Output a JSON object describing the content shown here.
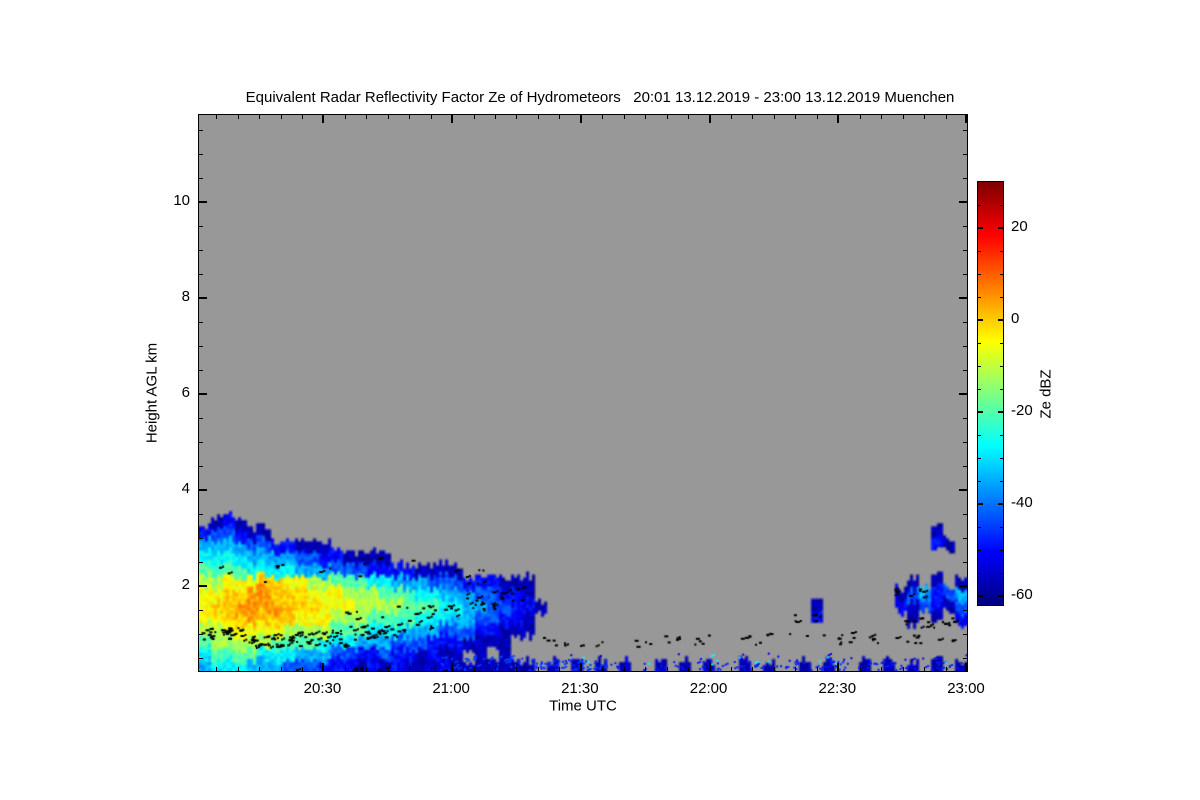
{
  "title": "Equivalent Radar Reflectivity Factor Ze of Hydrometeors   20:01 13.12.2019 - 23:00 13.12.2019 Muenchen",
  "station": "Muenchen",
  "period": "20:01 13.12.2019 - 23:00 13.12.2019",
  "colors": {
    "background": "#ffffff",
    "no_echo_gray": "#989898",
    "frame": "#000000",
    "text": "#000000",
    "dot_marker": "#000000"
  },
  "chart_data": {
    "type": "heatmap",
    "title": "Equivalent Radar Reflectivity Factor Ze of Hydrometeors   20:01 13.12.2019 - 23:00 13.12.2019 Muenchen",
    "xlabel": "Time UTC",
    "ylabel": "Height AGL km",
    "x_start_utc": "20:01",
    "x_end_utc": "23:00",
    "x_total_min": 179,
    "x_major_ticks": [
      {
        "label": "20:30",
        "min": 29
      },
      {
        "label": "21:00",
        "min": 59
      },
      {
        "label": "21:30",
        "min": 89
      },
      {
        "label": "22:00",
        "min": 119
      },
      {
        "label": "22:30",
        "min": 149
      },
      {
        "label": "23:00",
        "min": 179
      }
    ],
    "x_minor_step_min": 5,
    "ylim_km": [
      0.23,
      11.81
    ],
    "y_major_ticks": [
      {
        "label": "2",
        "km": 2
      },
      {
        "label": "4",
        "km": 4
      },
      {
        "label": "6",
        "km": 6
      },
      {
        "label": "8",
        "km": 8
      },
      {
        "label": "10",
        "km": 10
      }
    ],
    "y_minor_step_km": 0.5,
    "grid_lines": false,
    "colorbar": {
      "label": "Ze dBZ",
      "units": "dBZ",
      "colormap": "jet",
      "vmin": -62,
      "vmax": 30,
      "major_ticks": [
        {
          "label": "20",
          "v": 20
        },
        {
          "label": "0",
          "v": 0
        },
        {
          "label": "-20",
          "v": -20
        },
        {
          "label": "-40",
          "v": -40
        },
        {
          "label": "-60",
          "v": -60
        }
      ],
      "minor_step": 5
    },
    "grid": {
      "comment": "Coded dBZ raster of radar echo, 64 time columns x 15 height rows; '.'=no echo",
      "t0_min": 0,
      "dt_min": 2.797,
      "h_bottom_km": 0.23,
      "h_top_km": 4.0,
      "n_cols": 64,
      "n_rows": 15,
      "value_codes": {
        "a": -57,
        "b": -50,
        "c": -43,
        "d": -35,
        "e": -28,
        "f": -20,
        "g": -12,
        "h": -5,
        "i": 0,
        "j": 5
      },
      "rows_top_to_bottom": [
        "................................................................",
        "................................................................",
        ".aba............................................................",
        "bccbaa.......................................................a..",
        "ddddccbbaaa..................................................ba.",
        "eeeeddddccbbaaaa................................................",
        "ffffeeeedddcccbbbbaaaa..........................................",
        "gghhhiihhggfffeedddcccbbbaaa...............................a.a.a",
        "hhiijjiiihhhgggfffeedddccbba..............................acdbcd",
        "hiijjjjiiihhhggggfffeeddccbba......................a......bacbac",
        "hhiijiiihhhgggffffeeeddccbba.......................b.......a.a.b",
        "gghhhhhggggfffeeedddcccbbaaa....................................",
        "fgggggffffeeedddcccbbbaaaa......................................",
        "effffeeedddccbbcbbabaa.a.a......................................",
        "deeedddcccbbbababaaabaaaaaaa.a.a.a.a..a.a.a..a.a..a.a..a.a.a.a.a"
      ]
    },
    "black_dot_bands": [
      {
        "t0": 0,
        "t1": 10,
        "h0": 0.9,
        "h1": 1.15,
        "n": 34
      },
      {
        "t0": 10,
        "t1": 22,
        "h0": 0.72,
        "h1": 1.0,
        "n": 40
      },
      {
        "t0": 22,
        "t1": 34,
        "h0": 0.75,
        "h1": 1.1,
        "n": 34
      },
      {
        "t0": 34,
        "t1": 46,
        "h0": 0.9,
        "h1": 1.2,
        "n": 28
      },
      {
        "t0": 46,
        "t1": 55,
        "h0": 1.05,
        "h1": 1.3,
        "n": 10
      },
      {
        "t0": 50,
        "t1": 60,
        "h0": 1.35,
        "h1": 1.65,
        "n": 14
      },
      {
        "t0": 60,
        "t1": 70,
        "h0": 1.5,
        "h1": 1.85,
        "n": 16
      },
      {
        "t0": 68,
        "t1": 77,
        "h0": 1.7,
        "h1": 2.0,
        "n": 12
      },
      {
        "t0": 57,
        "t1": 68,
        "h0": 2.05,
        "h1": 2.35,
        "n": 7
      },
      {
        "t0": 4,
        "t1": 50,
        "h0": 2.1,
        "h1": 2.65,
        "n": 12
      },
      {
        "t0": 30,
        "t1": 50,
        "h0": 1.3,
        "h1": 1.6,
        "n": 7
      },
      {
        "t0": 20,
        "t1": 62,
        "h0": 0.24,
        "h1": 0.32,
        "n": 10
      },
      {
        "t0": 80,
        "t1": 105,
        "h0": 0.75,
        "h1": 1.0,
        "n": 14
      },
      {
        "t0": 105,
        "t1": 130,
        "h0": 0.78,
        "h1": 1.0,
        "n": 13
      },
      {
        "t0": 130,
        "t1": 160,
        "h0": 0.8,
        "h1": 1.05,
        "n": 20
      },
      {
        "t0": 160,
        "t1": 178,
        "h0": 0.8,
        "h1": 1.0,
        "n": 10
      },
      {
        "t0": 138,
        "t1": 145,
        "h0": 1.25,
        "h1": 1.42,
        "n": 8
      },
      {
        "t0": 162,
        "t1": 169,
        "h0": 1.78,
        "h1": 1.96,
        "n": 10
      },
      {
        "t0": 164,
        "t1": 176,
        "h0": 1.15,
        "h1": 1.35,
        "n": 18
      }
    ],
    "noise_speck_bands": [
      {
        "t0": 55,
        "t1": 76,
        "h0": 0.26,
        "h1": 0.55,
        "n": 40,
        "dbz": -45
      },
      {
        "t0": 76,
        "t1": 95,
        "h0": 0.26,
        "h1": 0.5,
        "n": 60,
        "dbz": -46
      },
      {
        "t0": 95,
        "t1": 179,
        "h0": 0.26,
        "h1": 0.45,
        "n": 110,
        "dbz": -48
      },
      {
        "t0": 80,
        "t1": 179,
        "h0": 0.45,
        "h1": 0.62,
        "n": 22,
        "dbz": -52
      },
      {
        "t0": 82,
        "t1": 178,
        "h0": 0.38,
        "h1": 0.58,
        "n": 14,
        "dbz": -27
      }
    ]
  }
}
